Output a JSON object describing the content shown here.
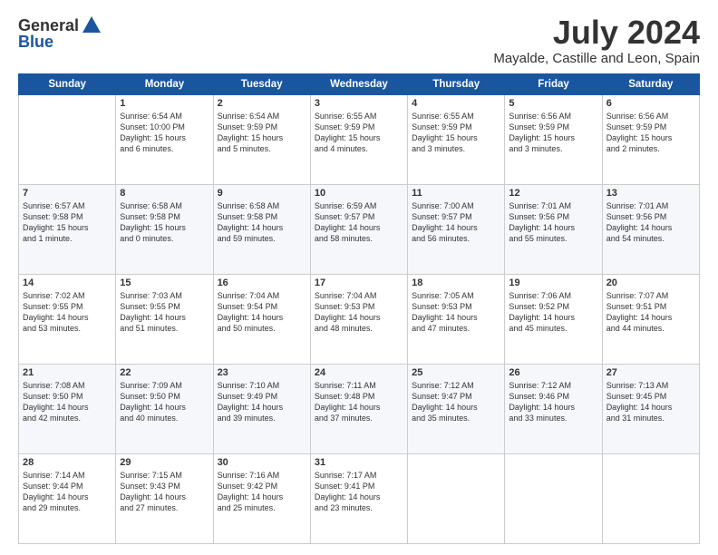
{
  "header": {
    "logo_general": "General",
    "logo_blue": "Blue",
    "month": "July 2024",
    "location": "Mayalde, Castille and Leon, Spain"
  },
  "weekdays": [
    "Sunday",
    "Monday",
    "Tuesday",
    "Wednesday",
    "Thursday",
    "Friday",
    "Saturday"
  ],
  "weeks": [
    [
      {
        "day": "",
        "info": ""
      },
      {
        "day": "1",
        "info": "Sunrise: 6:54 AM\nSunset: 10:00 PM\nDaylight: 15 hours\nand 6 minutes."
      },
      {
        "day": "2",
        "info": "Sunrise: 6:54 AM\nSunset: 9:59 PM\nDaylight: 15 hours\nand 5 minutes."
      },
      {
        "day": "3",
        "info": "Sunrise: 6:55 AM\nSunset: 9:59 PM\nDaylight: 15 hours\nand 4 minutes."
      },
      {
        "day": "4",
        "info": "Sunrise: 6:55 AM\nSunset: 9:59 PM\nDaylight: 15 hours\nand 3 minutes."
      },
      {
        "day": "5",
        "info": "Sunrise: 6:56 AM\nSunset: 9:59 PM\nDaylight: 15 hours\nand 3 minutes."
      },
      {
        "day": "6",
        "info": "Sunrise: 6:56 AM\nSunset: 9:59 PM\nDaylight: 15 hours\nand 2 minutes."
      }
    ],
    [
      {
        "day": "7",
        "info": "Sunrise: 6:57 AM\nSunset: 9:58 PM\nDaylight: 15 hours\nand 1 minute."
      },
      {
        "day": "8",
        "info": "Sunrise: 6:58 AM\nSunset: 9:58 PM\nDaylight: 15 hours\nand 0 minutes."
      },
      {
        "day": "9",
        "info": "Sunrise: 6:58 AM\nSunset: 9:58 PM\nDaylight: 14 hours\nand 59 minutes."
      },
      {
        "day": "10",
        "info": "Sunrise: 6:59 AM\nSunset: 9:57 PM\nDaylight: 14 hours\nand 58 minutes."
      },
      {
        "day": "11",
        "info": "Sunrise: 7:00 AM\nSunset: 9:57 PM\nDaylight: 14 hours\nand 56 minutes."
      },
      {
        "day": "12",
        "info": "Sunrise: 7:01 AM\nSunset: 9:56 PM\nDaylight: 14 hours\nand 55 minutes."
      },
      {
        "day": "13",
        "info": "Sunrise: 7:01 AM\nSunset: 9:56 PM\nDaylight: 14 hours\nand 54 minutes."
      }
    ],
    [
      {
        "day": "14",
        "info": "Sunrise: 7:02 AM\nSunset: 9:55 PM\nDaylight: 14 hours\nand 53 minutes."
      },
      {
        "day": "15",
        "info": "Sunrise: 7:03 AM\nSunset: 9:55 PM\nDaylight: 14 hours\nand 51 minutes."
      },
      {
        "day": "16",
        "info": "Sunrise: 7:04 AM\nSunset: 9:54 PM\nDaylight: 14 hours\nand 50 minutes."
      },
      {
        "day": "17",
        "info": "Sunrise: 7:04 AM\nSunset: 9:53 PM\nDaylight: 14 hours\nand 48 minutes."
      },
      {
        "day": "18",
        "info": "Sunrise: 7:05 AM\nSunset: 9:53 PM\nDaylight: 14 hours\nand 47 minutes."
      },
      {
        "day": "19",
        "info": "Sunrise: 7:06 AM\nSunset: 9:52 PM\nDaylight: 14 hours\nand 45 minutes."
      },
      {
        "day": "20",
        "info": "Sunrise: 7:07 AM\nSunset: 9:51 PM\nDaylight: 14 hours\nand 44 minutes."
      }
    ],
    [
      {
        "day": "21",
        "info": "Sunrise: 7:08 AM\nSunset: 9:50 PM\nDaylight: 14 hours\nand 42 minutes."
      },
      {
        "day": "22",
        "info": "Sunrise: 7:09 AM\nSunset: 9:50 PM\nDaylight: 14 hours\nand 40 minutes."
      },
      {
        "day": "23",
        "info": "Sunrise: 7:10 AM\nSunset: 9:49 PM\nDaylight: 14 hours\nand 39 minutes."
      },
      {
        "day": "24",
        "info": "Sunrise: 7:11 AM\nSunset: 9:48 PM\nDaylight: 14 hours\nand 37 minutes."
      },
      {
        "day": "25",
        "info": "Sunrise: 7:12 AM\nSunset: 9:47 PM\nDaylight: 14 hours\nand 35 minutes."
      },
      {
        "day": "26",
        "info": "Sunrise: 7:12 AM\nSunset: 9:46 PM\nDaylight: 14 hours\nand 33 minutes."
      },
      {
        "day": "27",
        "info": "Sunrise: 7:13 AM\nSunset: 9:45 PM\nDaylight: 14 hours\nand 31 minutes."
      }
    ],
    [
      {
        "day": "28",
        "info": "Sunrise: 7:14 AM\nSunset: 9:44 PM\nDaylight: 14 hours\nand 29 minutes."
      },
      {
        "day": "29",
        "info": "Sunrise: 7:15 AM\nSunset: 9:43 PM\nDaylight: 14 hours\nand 27 minutes."
      },
      {
        "day": "30",
        "info": "Sunrise: 7:16 AM\nSunset: 9:42 PM\nDaylight: 14 hours\nand 25 minutes."
      },
      {
        "day": "31",
        "info": "Sunrise: 7:17 AM\nSunset: 9:41 PM\nDaylight: 14 hours\nand 23 minutes."
      },
      {
        "day": "",
        "info": ""
      },
      {
        "day": "",
        "info": ""
      },
      {
        "day": "",
        "info": ""
      }
    ]
  ]
}
